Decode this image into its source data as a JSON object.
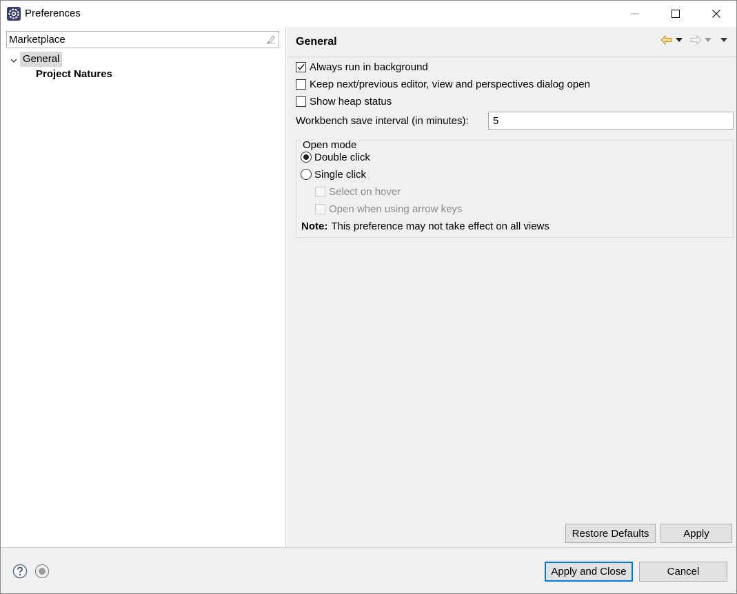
{
  "window": {
    "title": "Preferences",
    "app_icon": "eclipse-gear-icon",
    "controls": [
      "minimize-icon",
      "maximize-icon",
      "close-icon"
    ]
  },
  "left": {
    "filter": {
      "value": "Marketplace",
      "clear_icon": "clear-filter-icon"
    },
    "tree": {
      "general": "General",
      "project_natures": "Project Natures"
    }
  },
  "page": {
    "title": "General",
    "nav": [
      "back-arrow-icon",
      "dropdown-icon",
      "forward-arrow-icon",
      "dropdown-icon",
      "view-menu-icon"
    ],
    "options": {
      "always_run_bg": {
        "label": "Always run in background",
        "checked": true
      },
      "keep_dialog_open": {
        "label": "Keep next/previous editor, view and perspectives dialog open",
        "checked": false
      },
      "show_heap": {
        "label": "Show heap status",
        "checked": false
      }
    },
    "save_interval": {
      "label": "Workbench save interval (in minutes):",
      "value": "5"
    },
    "open_mode": {
      "legend": "Open mode",
      "double_click": "Double click",
      "single_click": "Single click",
      "select_on_hover": "Select on hover",
      "open_arrow_keys": "Open when using arrow keys",
      "note_bold": "Note:",
      "note_text": "This preference may not take effect on all views"
    },
    "buttons": {
      "restore_defaults": "Restore Defaults",
      "apply": "Apply"
    }
  },
  "footer": {
    "apply_close": "Apply and Close",
    "cancel": "Cancel",
    "icons": [
      "help-icon",
      "import-export-icon"
    ]
  },
  "colors": {
    "accent": "#0078d7",
    "panel_bg": "#f0f0f0",
    "selection_bg": "#d9d9d9",
    "nav_back": "#e0a83a"
  }
}
